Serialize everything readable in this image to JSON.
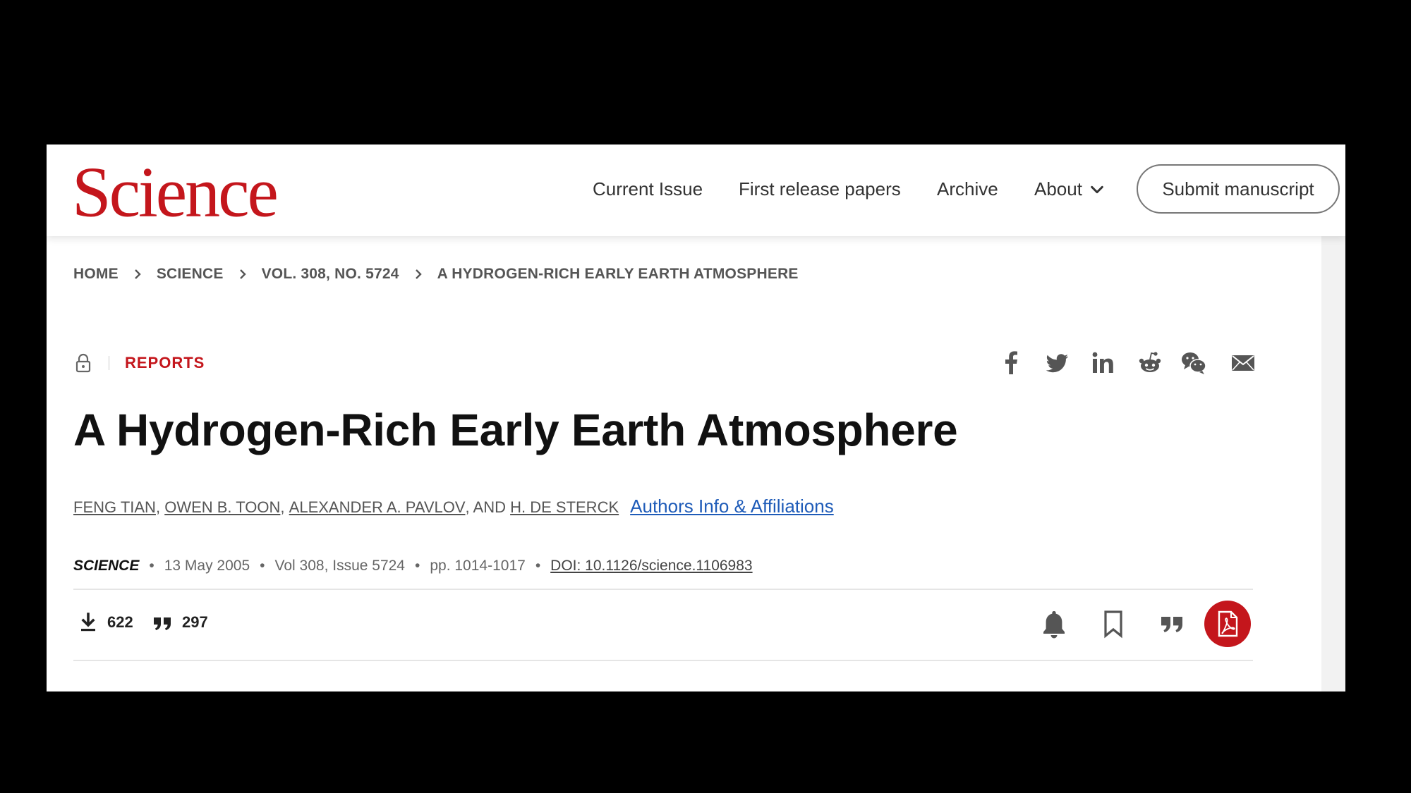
{
  "brand": {
    "logo_text": "Science",
    "accent_color": "#c4161c",
    "link_color": "#1e5bb8"
  },
  "nav": {
    "current_issue": "Current Issue",
    "first_release": "First release papers",
    "archive": "Archive",
    "about": "About",
    "submit": "Submit manuscript"
  },
  "breadcrumb": [
    "HOME",
    "SCIENCE",
    "VOL. 308, NO. 5724",
    "A HYDROGEN-RICH EARLY EARTH ATMOSPHERE"
  ],
  "article": {
    "type": "REPORTS",
    "title": "A Hydrogen-Rich Early Earth Atmosphere",
    "authors": [
      "FENG TIAN",
      "OWEN B. TOON",
      "ALEXANDER A. PAVLOV",
      "H. DE STERCK"
    ],
    "author_sep": ",",
    "author_and": ", AND",
    "affiliations_link": "Authors Info & Affiliations",
    "journal": "SCIENCE",
    "date": "13 May 2005",
    "volume_issue": "Vol 308, Issue 5724",
    "pages": "pp. 1014-1017",
    "doi": "DOI: 10.1126/science.1106983",
    "dot": "•"
  },
  "metrics": {
    "downloads": "622",
    "citations": "297"
  },
  "share_icons": [
    "facebook-icon",
    "twitter-icon",
    "linkedin-icon",
    "reddit-icon",
    "wechat-icon",
    "email-icon"
  ],
  "action_icons": [
    "bell-icon",
    "bookmark-icon",
    "quote-icon",
    "pdf-icon"
  ]
}
